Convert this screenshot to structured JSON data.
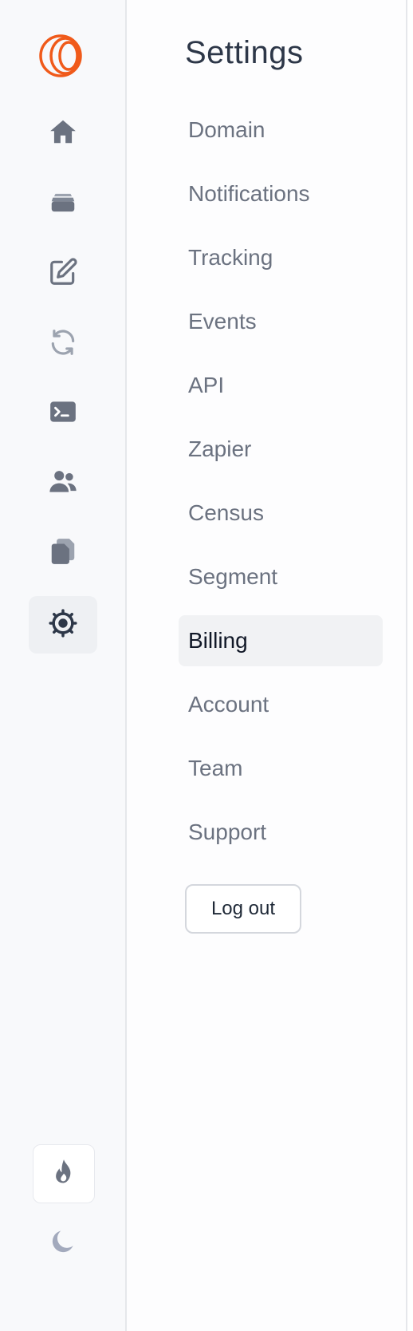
{
  "rail": {
    "items": [
      {
        "icon": "home-icon"
      },
      {
        "icon": "inbox-tray-icon"
      },
      {
        "icon": "edit-icon"
      },
      {
        "icon": "refresh-icon"
      },
      {
        "icon": "terminal-icon"
      },
      {
        "icon": "users-icon"
      },
      {
        "icon": "documents-icon"
      },
      {
        "icon": "gear-icon",
        "active": true
      }
    ],
    "bottom": [
      {
        "icon": "flame-icon"
      },
      {
        "icon": "moon-icon"
      }
    ]
  },
  "settings": {
    "title": "Settings",
    "items": [
      {
        "label": "Domain"
      },
      {
        "label": "Notifications"
      },
      {
        "label": "Tracking"
      },
      {
        "label": "Events"
      },
      {
        "label": "API"
      },
      {
        "label": "Zapier"
      },
      {
        "label": "Census"
      },
      {
        "label": "Segment"
      },
      {
        "label": "Billing",
        "active": true
      },
      {
        "label": "Account"
      },
      {
        "label": "Team"
      },
      {
        "label": "Support"
      }
    ],
    "logout_label": "Log out"
  },
  "colors": {
    "brand": "#f05a1a",
    "icon": "#6b7280",
    "icon_light": "#9ca3af",
    "active_icon": "#2d3748",
    "text": "#6b7280",
    "text_active": "#111827"
  }
}
